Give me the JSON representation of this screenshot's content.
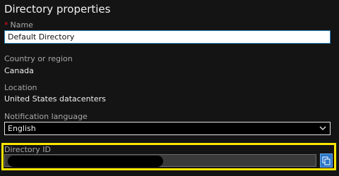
{
  "panel": {
    "title": "Directory properties",
    "name": {
      "label": "Name",
      "required_marker": "*",
      "value": "Default Directory"
    },
    "country": {
      "label": "Country or region",
      "value": "Canada"
    },
    "location": {
      "label": "Location",
      "value": "United States datacenters"
    },
    "notification_language": {
      "label": "Notification language",
      "value": "English"
    },
    "directory_id": {
      "label": "Directory ID",
      "value_redacted": true
    }
  },
  "icons": {
    "chevron": "chevron-down-icon",
    "copy": "copy-icon"
  },
  "colors": {
    "background": "#141414",
    "highlight": "#ffe600",
    "required": "#e81123",
    "focus_border": "#2f89c9",
    "copy_button": "#2a76c9"
  }
}
